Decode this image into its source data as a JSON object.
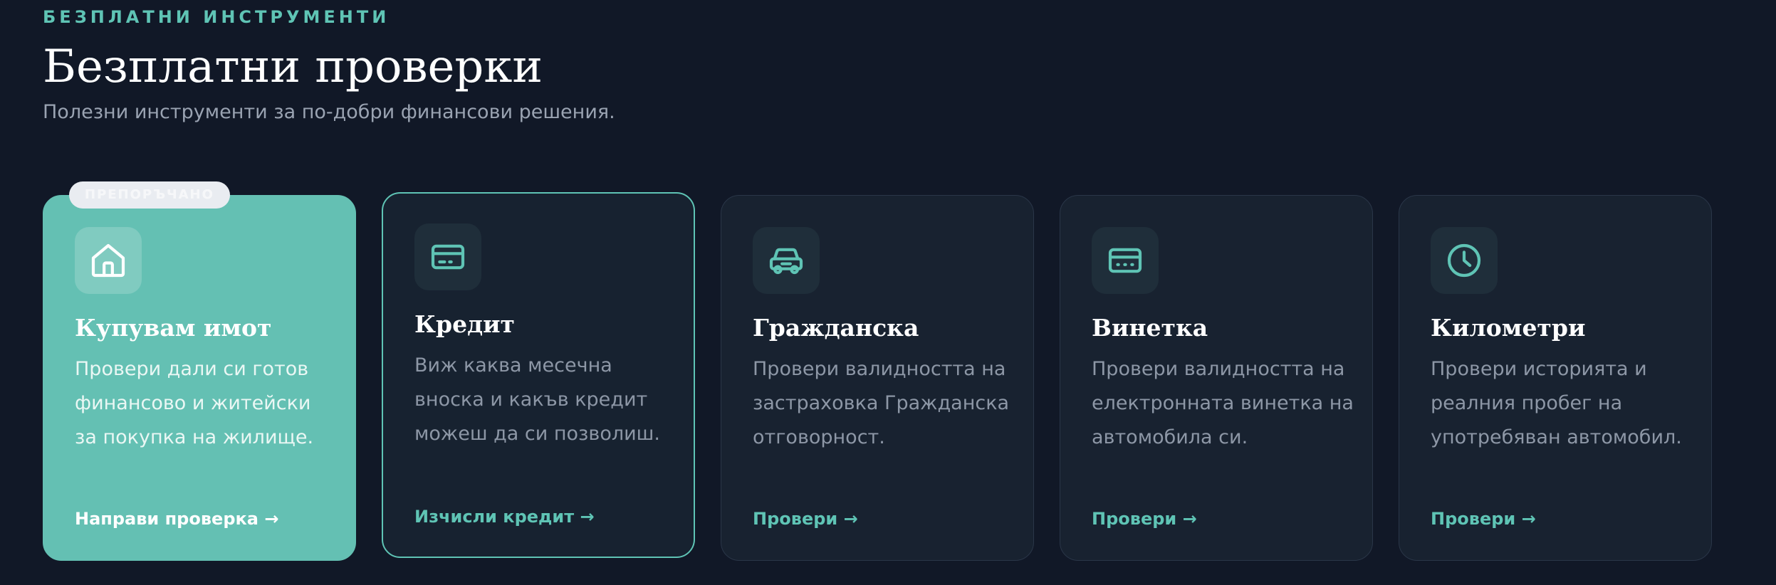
{
  "section": {
    "eyebrow": "БЕЗПЛАТНИ ИНСТРУМЕНТИ",
    "title": "Безплатни проверки",
    "subtitle": "Полезни инструменти за по-добри финансови решения."
  },
  "cards": [
    {
      "badge": "ПРЕПОРЪЧАНО",
      "icon": "home-icon",
      "title": "Купувам имот",
      "description": "Провери дали си готов финансово и житейски за покупка на жилище.",
      "link": "Направи проверка →"
    },
    {
      "icon": "credit-card-icon",
      "title": "Кредит",
      "description": "Виж каква месечна вноска и какъв кредит можеш да си позволиш.",
      "link": "Изчисли кредит →"
    },
    {
      "icon": "car-icon",
      "title": "Гражданска",
      "description": "Провери валидността на застраховка Гражданска отговорност.",
      "link": "Провери →"
    },
    {
      "icon": "ticket-card-icon",
      "title": "Винетка",
      "description": "Провери валидността на електронната винетка на автомобила си.",
      "link": "Провери →"
    },
    {
      "icon": "clock-icon",
      "title": "Километри",
      "description": "Провери историята и реалния пробег на употребяван автомобил.",
      "link": "Провери →"
    }
  ],
  "colors": {
    "background": "#111827",
    "accent": "#5fc4b5",
    "featured_card": "#64c0b3",
    "card": "#182230"
  }
}
